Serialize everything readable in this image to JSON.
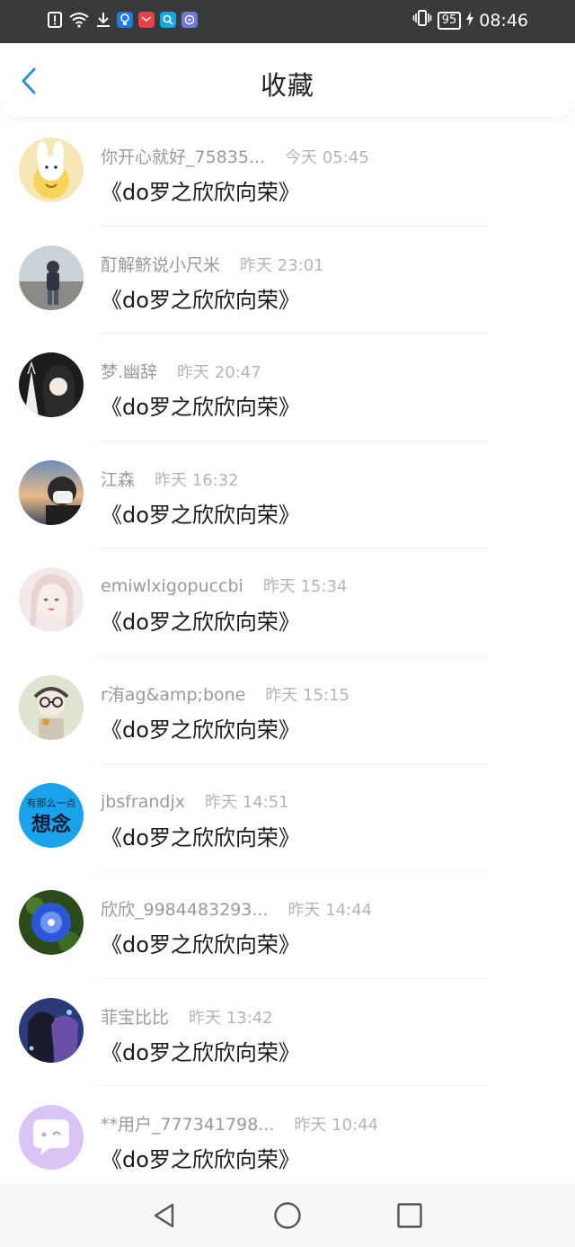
{
  "status_bar": {
    "time": "08:46",
    "battery": "95",
    "left_icons": [
      "alert-icon",
      "wifi-icon",
      "download-icon",
      "bulb-app-icon",
      "mail-app-icon",
      "search-app-icon",
      "music-app-icon"
    ],
    "right_icons": [
      "vibrate-icon",
      "battery-icon",
      "charging-icon"
    ]
  },
  "header": {
    "title": "收藏",
    "accent_color": "#2f8fe0"
  },
  "items": [
    {
      "user": "你开心就好_75835...",
      "time": "今天 05:45",
      "content": "《do罗之欣欣向荣》",
      "avatar": "bunny-cartoon"
    },
    {
      "user": "酊解鲚说小尺米",
      "time": "昨天 23:01",
      "content": "《do罗之欣欣向荣》",
      "avatar": "person-photo"
    },
    {
      "user": "梦.幽辞",
      "time": "昨天 20:47",
      "content": "《do罗之欣欣向荣》",
      "avatar": "anime-girl"
    },
    {
      "user": "江森",
      "time": "昨天 16:32",
      "content": "《do罗之欣欣向荣》",
      "avatar": "sunset-man"
    },
    {
      "user": "emiwlxigopuccbi",
      "time": "昨天 15:34",
      "content": "《do罗之欣欣向荣》",
      "avatar": "pale-girl"
    },
    {
      "user": "r洧ag&amp;bone",
      "time": "昨天 15:15",
      "content": "《do罗之欣欣向荣》",
      "avatar": "glasses-man"
    },
    {
      "user": "jbsfrandjx",
      "time": "昨天 14:51",
      "content": "《do罗之欣欣向荣》",
      "avatar": "blue-text",
      "avatar_text_small": "有那么一点",
      "avatar_text": "想念"
    },
    {
      "user": "欣欣_9984483293...",
      "time": "昨天 14:44",
      "content": "《do罗之欣欣向荣》",
      "avatar": "blue-flower"
    },
    {
      "user": "菲宝比比",
      "time": "昨天 13:42",
      "content": "《do罗之欣欣向荣》",
      "avatar": "anime-couple"
    },
    {
      "user": "**用户_777341798...",
      "time": "昨天 10:44",
      "content": "《do罗之欣欣向荣》",
      "avatar": "default-chat"
    }
  ],
  "nav_bar": {
    "buttons": [
      "back-triangle-icon",
      "home-circle-icon",
      "recents-square-icon"
    ]
  }
}
